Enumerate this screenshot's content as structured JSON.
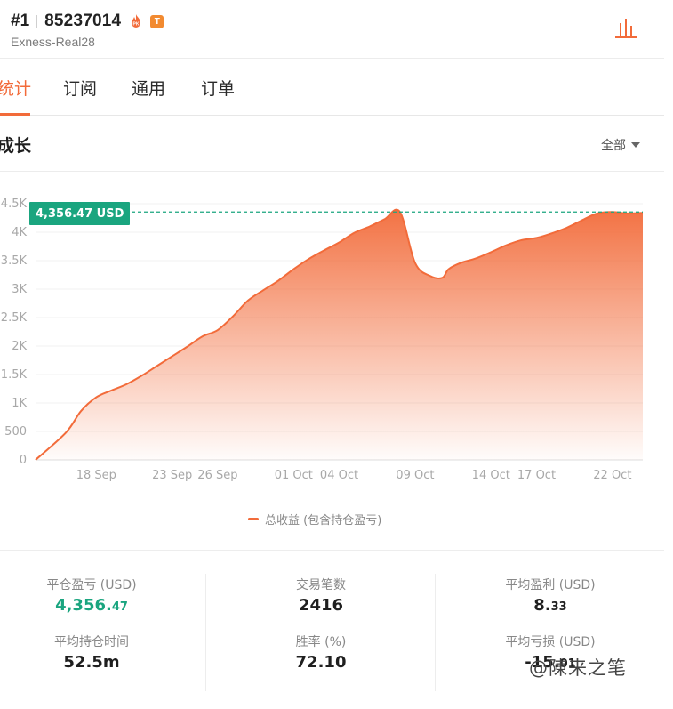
{
  "header": {
    "rank": "#1",
    "account": "85237014",
    "badge_t": "T",
    "server": "Exness-Real28",
    "icons": {
      "pk": "flame-pk-icon",
      "chart": "bar-chart-icon"
    }
  },
  "tabs": [
    {
      "label": "统计",
      "active": true
    },
    {
      "label": "订阅",
      "active": false
    },
    {
      "label": "通用",
      "active": false
    },
    {
      "label": "订单",
      "active": false
    }
  ],
  "section": {
    "title": "成长",
    "range_label": "全部"
  },
  "colors": {
    "accent": "#f26b3a",
    "green": "#1aa57f"
  },
  "chart_data": {
    "type": "area",
    "current_value_label": "4,356.47 USD",
    "y_ticks": [
      "0",
      "500",
      "1K",
      "1.5K",
      "2K",
      "2.5K",
      "3K",
      "3.5K",
      "4K",
      "4.5K"
    ],
    "x_ticks": [
      "18 Sep",
      "23 Sep",
      "26 Sep",
      "01 Oct",
      "04 Oct",
      "09 Oct",
      "14 Oct",
      "17 Oct",
      "22 Oct"
    ],
    "ylim": [
      0,
      4500
    ],
    "x_tick_index": [
      2,
      7,
      10,
      15,
      18,
      23,
      28,
      31,
      36
    ],
    "series": [
      {
        "name": "总收益 (包含持仓盈亏)",
        "x": [
          -2,
          0,
          1,
          2,
          3,
          4,
          5,
          6,
          7,
          8,
          9,
          10,
          11,
          12,
          13,
          14,
          15,
          16,
          17,
          18,
          19,
          20,
          21,
          22,
          23,
          24,
          24.8,
          25.2,
          26,
          27,
          28,
          29,
          30,
          31,
          32,
          33,
          34,
          35,
          36,
          37,
          38
        ],
        "values": [
          0,
          480,
          860,
          1100,
          1220,
          1330,
          1480,
          1650,
          1820,
          1990,
          2170,
          2280,
          2520,
          2800,
          2980,
          3150,
          3350,
          3530,
          3680,
          3820,
          3990,
          4100,
          4230,
          4356,
          3460,
          3230,
          3200,
          3350,
          3460,
          3540,
          3650,
          3770,
          3860,
          3900,
          3980,
          4080,
          4210,
          4330,
          4356,
          4330,
          4340
        ]
      }
    ],
    "grid": true,
    "legend": "bottom-center"
  },
  "stats": [
    {
      "label": "平仓盈亏 (USD)",
      "value_main": "4,356.",
      "value_small": "47",
      "color": "green"
    },
    {
      "label": "交易笔数",
      "value_main": "2416",
      "value_small": ""
    },
    {
      "label": "平均盈利 (USD)",
      "value_main": "8.",
      "value_small": "33"
    },
    {
      "label": "平均持仓时间",
      "value_main": "52.5m",
      "value_small": ""
    },
    {
      "label": "胜率 (%)",
      "value_main": "72.10",
      "value_small": ""
    },
    {
      "label": "平均亏损 (USD)",
      "value_main": "-15.",
      "value_small": "01"
    }
  ],
  "watermark": "@陳来之笔"
}
